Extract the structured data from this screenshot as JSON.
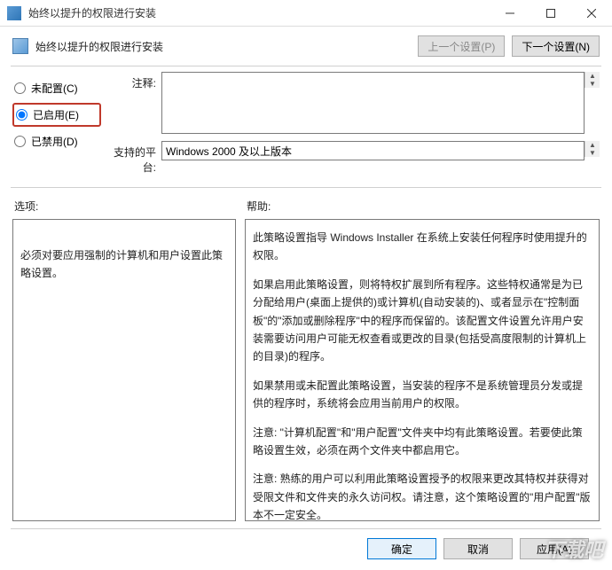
{
  "window": {
    "title": "始终以提升的权限进行安装"
  },
  "header": {
    "title": "始终以提升的权限进行安装",
    "prev_btn": "上一个设置(P)",
    "next_btn": "下一个设置(N)"
  },
  "radios": {
    "not_configured": "未配置(C)",
    "enabled": "已启用(E)",
    "disabled": "已禁用(D)",
    "selected": "enabled"
  },
  "fields": {
    "comment_label": "注释:",
    "comment_value": "",
    "platform_label": "支持的平台:",
    "platform_value": "Windows 2000 及以上版本"
  },
  "lower": {
    "options_label": "选项:",
    "options_text": "必须对要应用强制的计算机和用户设置此策略设置。",
    "help_label": "帮助:",
    "help_paragraphs": [
      "此策略设置指导 Windows Installer 在系统上安装任何程序时使用提升的权限。",
      "如果启用此策略设置，则将特权扩展到所有程序。这些特权通常是为已分配给用户(桌面上提供的)或计算机(自动安装的)、或者显示在\"控制面板\"的\"添加或删除程序\"中的程序而保留的。该配置文件设置允许用户安装需要访问用户可能无权查看或更改的目录(包括受高度限制的计算机上的目录)的程序。",
      "如果禁用或未配置此策略设置，当安装的程序不是系统管理员分发或提供的程序时，系统将会应用当前用户的权限。",
      "注意: \"计算机配置\"和\"用户配置\"文件夹中均有此策略设置。若要使此策略设置生效，必须在两个文件夹中都启用它。",
      "注意: 熟练的用户可以利用此策略设置授予的权限来更改其特权并获得对受限文件和文件夹的永久访问权。请注意，这个策略设置的\"用户配置\"版本不一定安全。"
    ]
  },
  "footer": {
    "ok": "确定",
    "cancel": "取消",
    "apply": "应用(A)"
  },
  "watermark": "下载吧"
}
